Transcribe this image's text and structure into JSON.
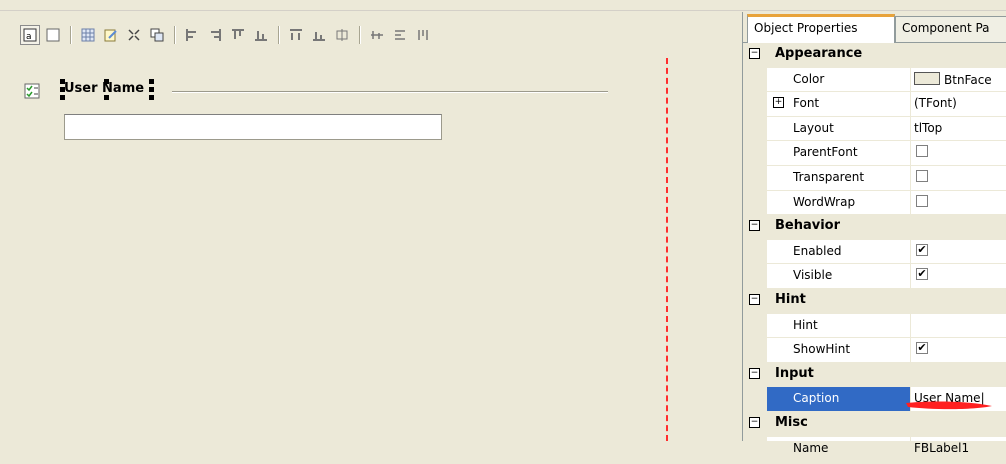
{
  "toolbar": {
    "icons": [
      "select-all-icon",
      "rectangle-icon",
      "grid-icon",
      "edit-icon",
      "align-icon",
      "bring-front-icon",
      "align-left-icon",
      "align-right-icon",
      "align-top-icon",
      "align-bottom-icon",
      "space-horizontal-icon",
      "space-vertical-icon",
      "center-horizontal-icon",
      "center-vertical-icon",
      "size-width-icon",
      "size-height-icon"
    ]
  },
  "designer": {
    "label_text": "User Name",
    "input_value": ""
  },
  "panel": {
    "tabs": [
      "Object Properties",
      "Component Pa"
    ],
    "categories": {
      "appearance": "Appearance",
      "behavior": "Behavior",
      "hint": "Hint",
      "input": "Input",
      "misc": "Misc"
    },
    "props": {
      "color": {
        "name": "Color",
        "value": "BtnFace"
      },
      "font": {
        "name": "Font",
        "value": "(TFont)"
      },
      "layout": {
        "name": "Layout",
        "value": "tlTop"
      },
      "parentfont": {
        "name": "ParentFont",
        "checked": false
      },
      "transparent": {
        "name": "Transparent",
        "checked": false
      },
      "wordwrap": {
        "name": "WordWrap",
        "checked": false
      },
      "enabled": {
        "name": "Enabled",
        "checked": true
      },
      "visible": {
        "name": "Visible",
        "checked": true
      },
      "hint": {
        "name": "Hint",
        "value": ""
      },
      "showhint": {
        "name": "ShowHint",
        "checked": true
      },
      "caption": {
        "name": "Caption",
        "value": "User Name|"
      },
      "name": {
        "name": "Name",
        "value": "FBLabel1"
      }
    }
  },
  "colors": {
    "background": "#ece9d8",
    "selection": "#316ac5",
    "tab_accent": "#e8a33b",
    "guide": "#ff2d2d",
    "annotation": "#ff2020"
  }
}
